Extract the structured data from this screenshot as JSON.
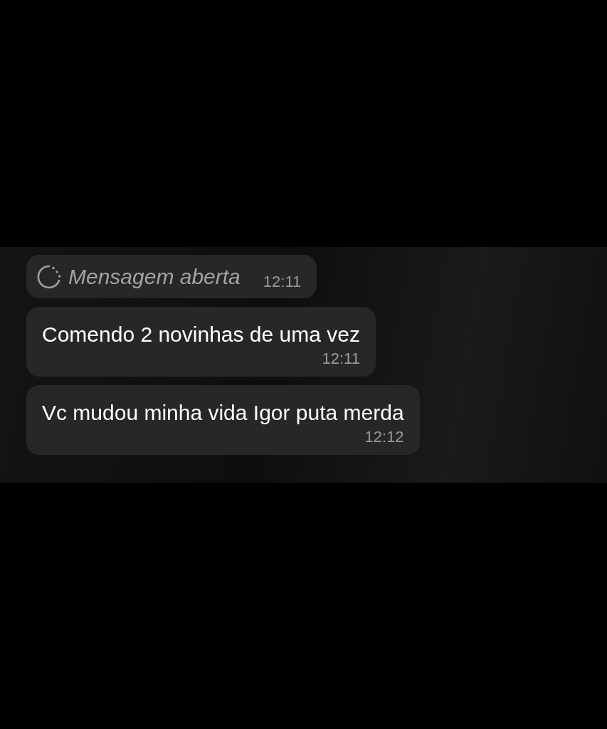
{
  "messages": [
    {
      "kind": "view_once",
      "text": "Mensagem aberta",
      "time": "12:11"
    },
    {
      "kind": "text",
      "text": "Comendo 2 novinhas de uma vez",
      "time": "12:11"
    },
    {
      "kind": "text",
      "text": "Vc mudou minha vida Igor puta merda",
      "time": "12:12"
    }
  ]
}
